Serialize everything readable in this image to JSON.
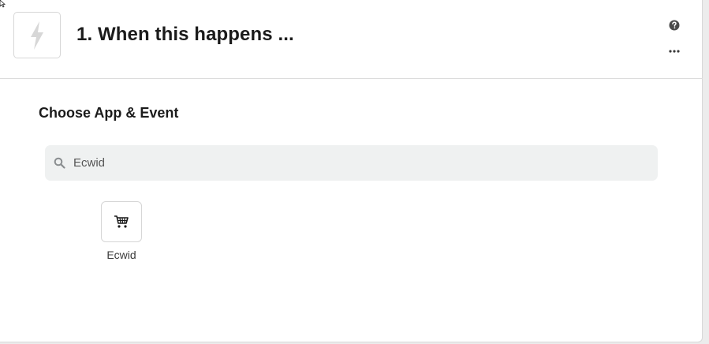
{
  "header": {
    "step_title": "1. When this happens ...",
    "trigger_icon": "lightning-bolt-icon",
    "help_icon": "question-circle-icon",
    "more_icon": "ellipsis-icon"
  },
  "main": {
    "section_title": "Choose App & Event",
    "search": {
      "value": "Ecwid",
      "icon": "search-icon"
    },
    "results": [
      {
        "label": "Ecwid",
        "icon": "shopping-cart-icon"
      }
    ]
  },
  "colors": {
    "search_background": "#eff1f1",
    "title_text": "#1b1b1b",
    "border": "#d7d7d7"
  }
}
